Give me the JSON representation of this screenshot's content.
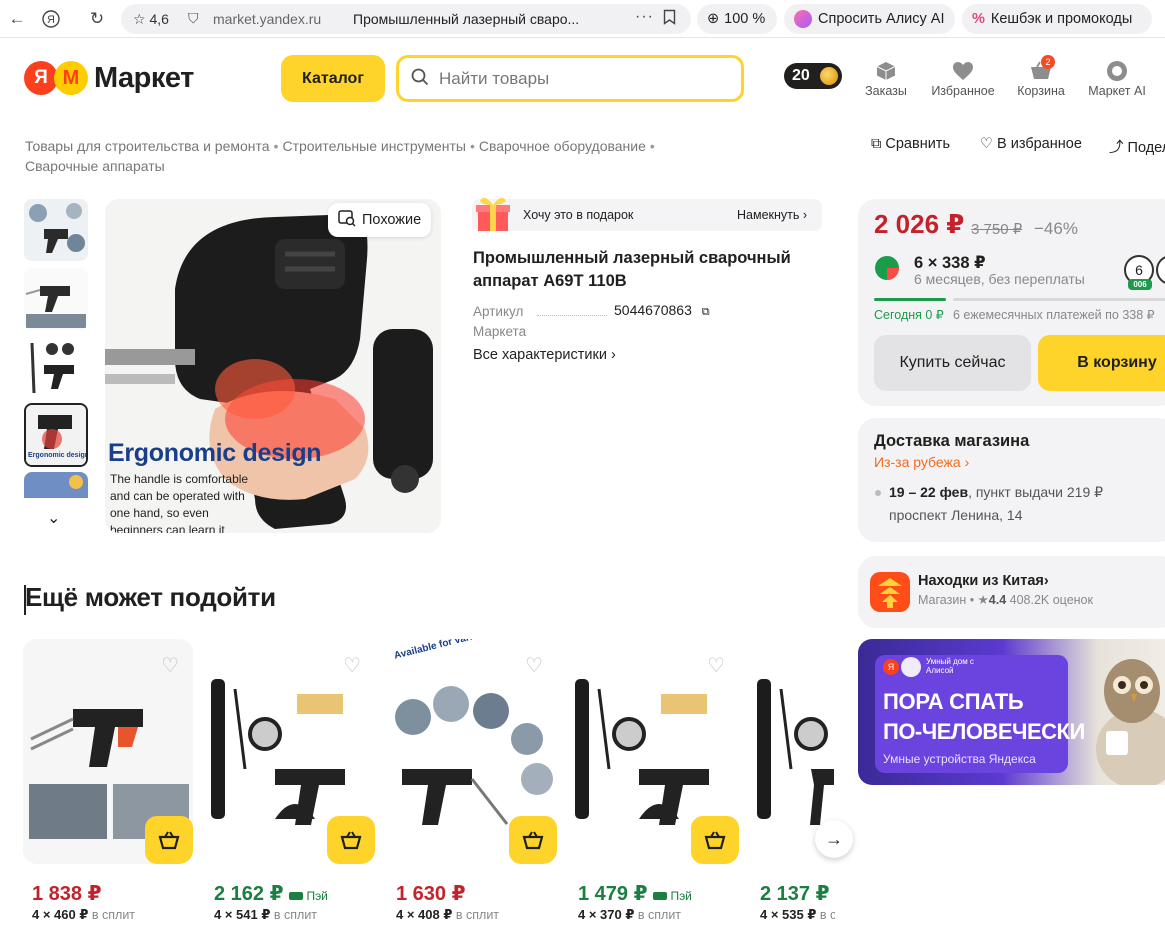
{
  "browser": {
    "rating": "4,6",
    "domain": "market.yandex.ru",
    "tab_title": "Промышленный лазерный сваро...",
    "zoom": "100 %",
    "alice_label": "Спросить Алису AI",
    "cashback_label": "Кешбэк и промокоды"
  },
  "header": {
    "logo_text": "Маркет",
    "logo_letter": "Я",
    "catalog_label": "Каталог",
    "search_placeholder": "Найти товары",
    "plus_points": "20",
    "nav": [
      {
        "label": "Заказы",
        "icon": "box-icon"
      },
      {
        "label": "Избранное",
        "icon": "heart-icon"
      },
      {
        "label": "Корзина",
        "icon": "cart-icon",
        "count": "2"
      },
      {
        "label": "Маркет AI",
        "icon": "ai-icon"
      }
    ]
  },
  "breadcrumb": [
    "Товары для строительства и ремонта",
    "Строительные инструменты",
    "Сварочное оборудование",
    "Сварочные аппараты"
  ],
  "actions": {
    "compare": "Сравнить",
    "favorite": "В избранное",
    "share": "Подел"
  },
  "gallery": {
    "similar_label": "Похожие",
    "image_heading": "Ergonomic design",
    "image_text": "The handle is comfortable and can be operated with one hand, so even beginners can learn it quickly."
  },
  "product": {
    "gift_text": "Хочу это в подарок",
    "gift_action": "Намекнуть",
    "title": "Промышленный лазерный сварочный аппарат A69T 110B",
    "article_label": "Артикул Маркета",
    "article_number": "5044670863",
    "all_specs": "Все характеристики"
  },
  "price": {
    "current": "2 026 ₽",
    "old": "3 750 ₽",
    "discount": "−46%",
    "installment_main": "6 × 338 ₽",
    "installment_sub": "6 месяцев, без переплаты",
    "today": "Сегодня 0 ₽",
    "monthly": "6 ежемесячных платежей по 338 ₽",
    "split_badge_num": "6",
    "split_badge_label": "006",
    "buy_now": "Купить сейчас",
    "to_cart": "В корзину",
    "colors": {
      "price": "#c4222a",
      "green": "#1a7f40",
      "yellow": "#fed42b"
    }
  },
  "delivery": {
    "title": "Доставка магазина",
    "origin": "Из-за рубежа",
    "dates": "19 – 22 фев",
    "method": ", пункт выдачи",
    "cost": "219 ₽",
    "address": "проспект Ленина, 14"
  },
  "seller": {
    "name": "Находки из Китая",
    "type": "Магазин",
    "rating": "4.4",
    "reviews": "408.2K оценок"
  },
  "ad": {
    "brand_line": "Умный дом с Алисой",
    "headline_1": "ПОРА СПАТЬ",
    "headline_2": "ПО-ЧЕЛОВЕЧЕСКИ",
    "sub": "Умные устройства Яндекса"
  },
  "more_section": {
    "title": "Ещё может подойти",
    "items": [
      {
        "price": "1 838",
        "split": "4 × 460 ₽",
        "split_label": "в сплит",
        "pay": "",
        "price_color": "#c4222a"
      },
      {
        "price": "2 162",
        "split": "4 × 541 ₽",
        "split_label": "в сплит",
        "pay": "Пэй",
        "price_color": "#1a7f40"
      },
      {
        "price": "1 630",
        "split": "4 × 408 ₽",
        "split_label": "в сплит",
        "pay": "",
        "price_color": "#c4222a"
      },
      {
        "price": "1 479",
        "split": "4 × 370 ₽",
        "split_label": "в сплит",
        "pay": "Пэй",
        "price_color": "#1a7f40"
      },
      {
        "price": "2 137",
        "split": "4 × 535 ₽",
        "split_label": "в с",
        "pay": "",
        "price_color": "#1a7f40"
      }
    ],
    "image_tag": "Available for various metal materials"
  }
}
